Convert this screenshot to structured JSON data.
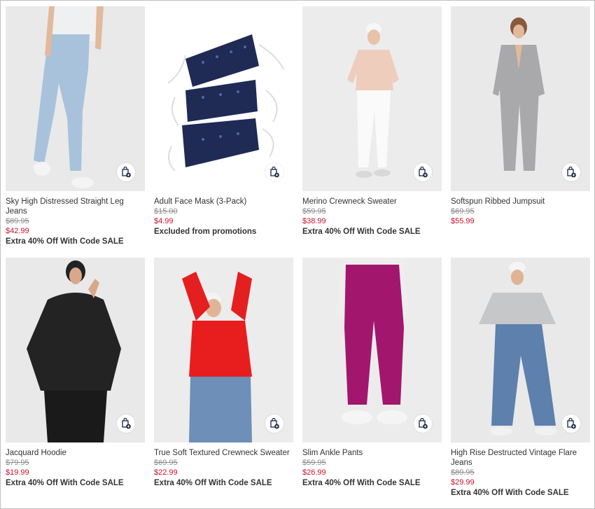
{
  "colors": {
    "sale": "#c8102e",
    "original": "#8c8c8c",
    "bag_icon": "#122344"
  },
  "products": [
    {
      "name": "Sky High Distressed Straight Leg Jeans",
      "original_price": "$89.95",
      "sale_price": "$42.99",
      "promo": "Extra 40% Off With Code SALE",
      "icon": "shopping-bag-add-icon"
    },
    {
      "name": "Adult Face Mask (3-Pack)",
      "original_price": "$15.00",
      "sale_price": "$4.99",
      "promo": "Excluded from promotions",
      "icon": "shopping-bag-add-icon"
    },
    {
      "name": "Merino Crewneck Sweater",
      "original_price": "$59.95",
      "sale_price": "$38.99",
      "promo": "Extra 40% Off With Code SALE",
      "icon": "shopping-bag-add-icon"
    },
    {
      "name": "Softspun Ribbed Jumpsuit",
      "original_price": "$69.95",
      "sale_price": "$55.99",
      "promo": "",
      "icon": "shopping-bag-add-icon"
    },
    {
      "name": "Jacquard Hoodie",
      "original_price": "$79.95",
      "sale_price": "$19.99",
      "promo": "Extra 40% Off With Code SALE",
      "icon": "shopping-bag-add-icon"
    },
    {
      "name": "True Soft Textured Crewneck Sweater",
      "original_price": "$69.95",
      "sale_price": "$22.99",
      "promo": "Extra 40% Off With Code SALE",
      "icon": "shopping-bag-add-icon"
    },
    {
      "name": "Slim Ankle Pants",
      "original_price": "$59.95",
      "sale_price": "$26.99",
      "promo": "Extra 40% Off With Code SALE",
      "icon": "shopping-bag-add-icon"
    },
    {
      "name": "High Rise Destructed Vintage Flare Jeans",
      "original_price": "$89.95",
      "sale_price": "$29.99",
      "promo": "Extra 40% Off With Code SALE",
      "icon": "shopping-bag-add-icon"
    }
  ]
}
